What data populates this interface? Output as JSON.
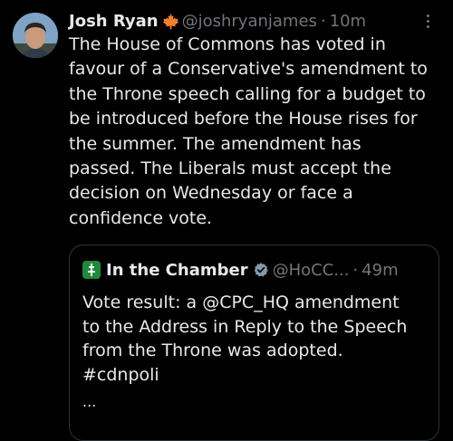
{
  "author": {
    "name": "Josh Ryan",
    "handle": "@joshryanjames",
    "separator": "·",
    "time": "10m",
    "badge_icon": "maple-leaf-icon"
  },
  "tweet_text": [
    "The House of Commons has voted in",
    "favour of a Conservative's amendment to",
    "the Throne speech calling for a budget to",
    "be introduced before the House rises for",
    "the summer. The amendment has",
    "passed. The Liberals must accept the",
    "decision on Wednesday or face a",
    "confidence vote."
  ],
  "quoted_tweet": {
    "name": "In the Chamber",
    "handle": "@HoCC...",
    "separator": "·",
    "time": "49m",
    "verified_icon": "verified-badge-icon",
    "text": [
      "Vote result: a @CPC_HQ amendment",
      "to the Address in Reply to the Speech",
      "from the Throne was adopted.",
      "#cdnpoli"
    ],
    "ellipsis": "..."
  },
  "colors": {
    "background": "#000000",
    "primary_text": "#e7e9ea",
    "secondary_text": "#71767b",
    "border": "#2f3336",
    "maple_leaf": "#f0802a",
    "quote_avatar": "#1f8a3b"
  }
}
